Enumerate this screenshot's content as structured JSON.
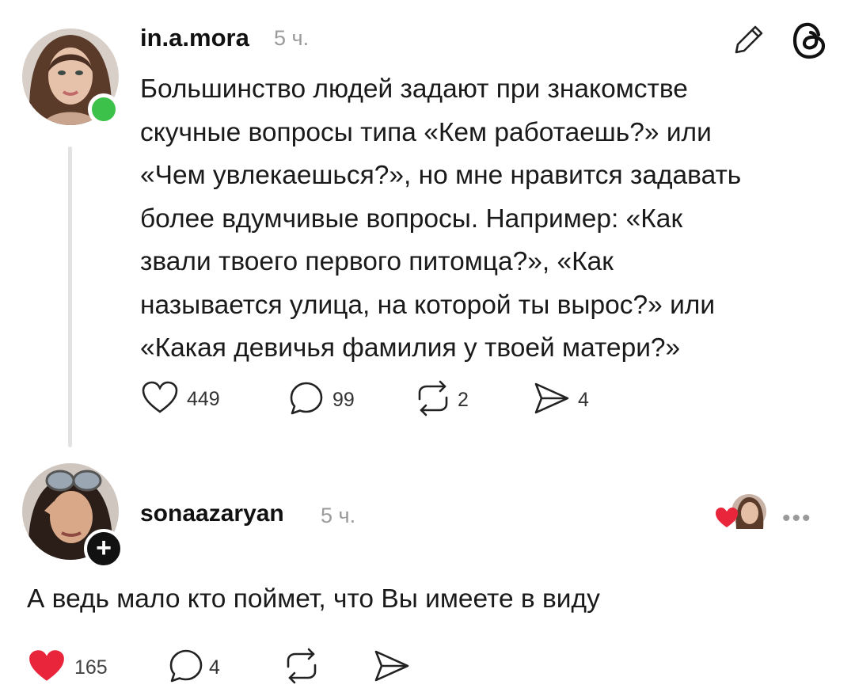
{
  "post": {
    "author": "in.a.mora",
    "time": "5 ч.",
    "text_lines": [
      "Большинство людей задают при знакомстве",
      "скучные вопросы типа «Кем работаешь?» или",
      "«Чем увлекаешься?», но мне нравится задавать",
      "более вдумчивые вопросы. Например: «Как",
      "звали твоего первого питомца?», «Как",
      "называется улица, на которой ты вырос?» или",
      "«Какая девичья фамилия у твоей матери?»"
    ],
    "likes": "449",
    "replies": "99",
    "reposts": "2",
    "shares": "4",
    "icons": [
      "edit-icon",
      "threads-logo-icon",
      "heart-icon",
      "comment-icon",
      "repost-icon",
      "send-icon"
    ]
  },
  "reply": {
    "author": "sonaazaryan",
    "time": "5 ч.",
    "text": "А ведь мало кто поймет, что Вы имеете в виду",
    "likes": "165",
    "replies": "4",
    "follow_symbol": "+",
    "more_symbol": "•••",
    "liked_color": "#e8253b"
  }
}
